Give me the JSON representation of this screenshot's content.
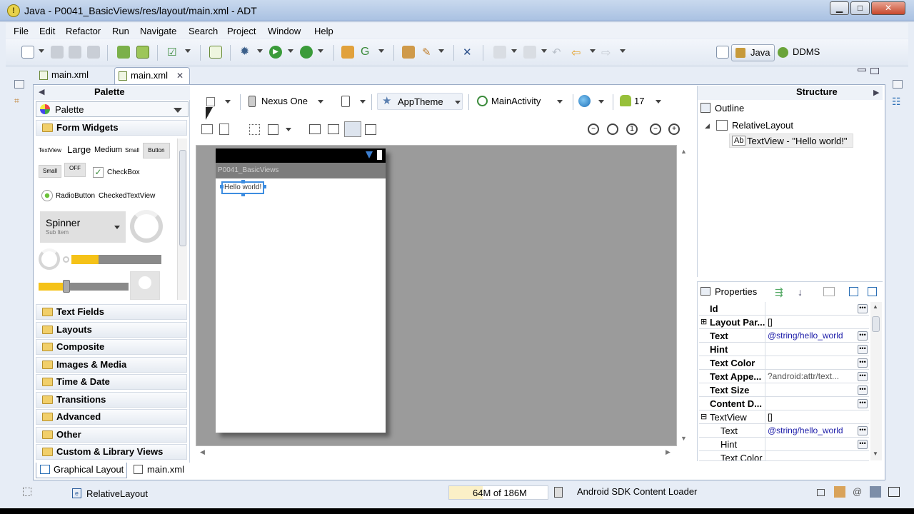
{
  "window": {
    "title": "Java - P0041_BasicViews/res/layout/main.xml - ADT",
    "minimize": "▁",
    "maximize": "□",
    "close": "✕"
  },
  "menu": [
    "File",
    "Edit",
    "Refactor",
    "Run",
    "Navigate",
    "Search",
    "Project",
    "Window",
    "Help"
  ],
  "perspectives": {
    "java": "Java",
    "ddms": "DDMS"
  },
  "editor_tabs": [
    {
      "label": "main.xml"
    },
    {
      "label": "main.xml",
      "close": "✕"
    }
  ],
  "palette": {
    "title": "Palette",
    "combo": "Palette",
    "form_widgets": "Form Widgets",
    "widgets": {
      "textview": "TextView",
      "large": "Large",
      "medium": "Medium",
      "small": "Small",
      "button": "Button",
      "small_button": "Small",
      "off": "OFF",
      "checkbox": "CheckBox",
      "radiobutton": "RadioButton",
      "checkedtextview": "CheckedTextView",
      "spinner": "Spinner",
      "subitem": "Sub Item"
    },
    "categories": [
      "Text Fields",
      "Layouts",
      "Composite",
      "Images & Media",
      "Time & Date",
      "Transitions",
      "Advanced",
      "Other",
      "Custom & Library Views"
    ]
  },
  "layout_toolbar": {
    "device": "Nexus One",
    "theme": "AppTheme",
    "activity": "MainActivity",
    "api": "17"
  },
  "device": {
    "app_title": "P0041_BasicViews",
    "textview": "Hello world!"
  },
  "structure": {
    "title": "Structure",
    "outline": "Outline",
    "root": "RelativeLayout",
    "child": "TextView - \"Hello world!\""
  },
  "properties": {
    "title": "Properties",
    "rows": [
      {
        "name": "Id",
        "value": ""
      },
      {
        "name": "Layout Par...",
        "value": "[]",
        "expand": "⊞"
      },
      {
        "name": "Text",
        "value": "@string/hello_world"
      },
      {
        "name": "Hint",
        "value": ""
      },
      {
        "name": "Text Color",
        "value": ""
      },
      {
        "name": "Text Appe...",
        "value": "?android:attr/text..."
      },
      {
        "name": "Text Size",
        "value": ""
      },
      {
        "name": "Content D...",
        "value": ""
      },
      {
        "name": "TextView",
        "value": "[]",
        "expand": "⊟",
        "group": true
      },
      {
        "name": "Text",
        "value": "@string/hello_world",
        "sub": true
      },
      {
        "name": "Hint",
        "value": "",
        "sub": true
      },
      {
        "name": "Text Color",
        "value": "",
        "sub": true
      }
    ]
  },
  "bottom_tabs": {
    "graphical": "Graphical Layout",
    "xml": "main.xml"
  },
  "status": {
    "selection": "RelativeLayout",
    "memory": "64M of 186M",
    "loader": "Android SDK Content Loader"
  },
  "colors": {
    "accent": "#3d8de0",
    "titlebar": "#a9c1e2",
    "canvas": "#9b9b9b",
    "link": "#1a1aa8"
  }
}
